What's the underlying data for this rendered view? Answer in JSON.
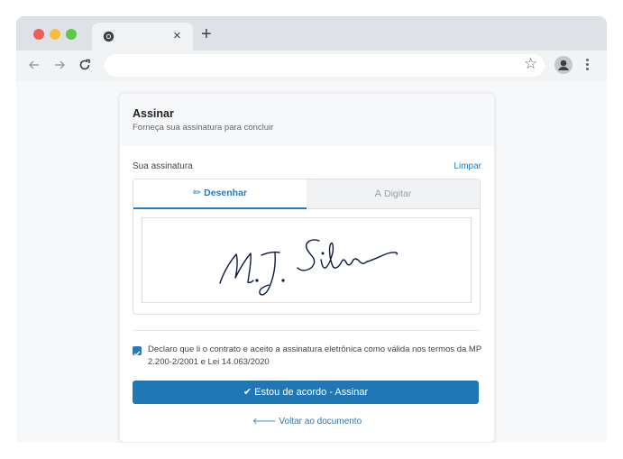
{
  "browser": {
    "tab": {
      "favicon": "chrome-icon",
      "close_label": "×"
    },
    "new_tab_label": "+",
    "toolbar": {
      "back": "back-arrow-icon",
      "forward": "forward-arrow-icon",
      "reload": "reload-icon",
      "bookmark_label": "☆"
    }
  },
  "card": {
    "title": "Assinar",
    "subtitle": "Forneça sua assinatura para concluir",
    "signature_label": "Sua assinatura",
    "clear_label": "Limpar",
    "tabs": [
      {
        "icon": "✏",
        "label": "Desenhar",
        "active": true
      },
      {
        "icon": "A",
        "label": "Digitar",
        "active": false
      }
    ],
    "consent_checked": true,
    "consent_text": "Declaro que li o contrato e aceito a assinatura eletrônica como válida nos termos da MP 2.200-2/2001 e Lei 14.063/2020",
    "agree_button": "✔ Estou de acordo - Assinar",
    "back_link": "🡐 Voltar ao documento"
  },
  "colors": {
    "accent": "#1f77b4",
    "link": "#2a7ab7"
  }
}
